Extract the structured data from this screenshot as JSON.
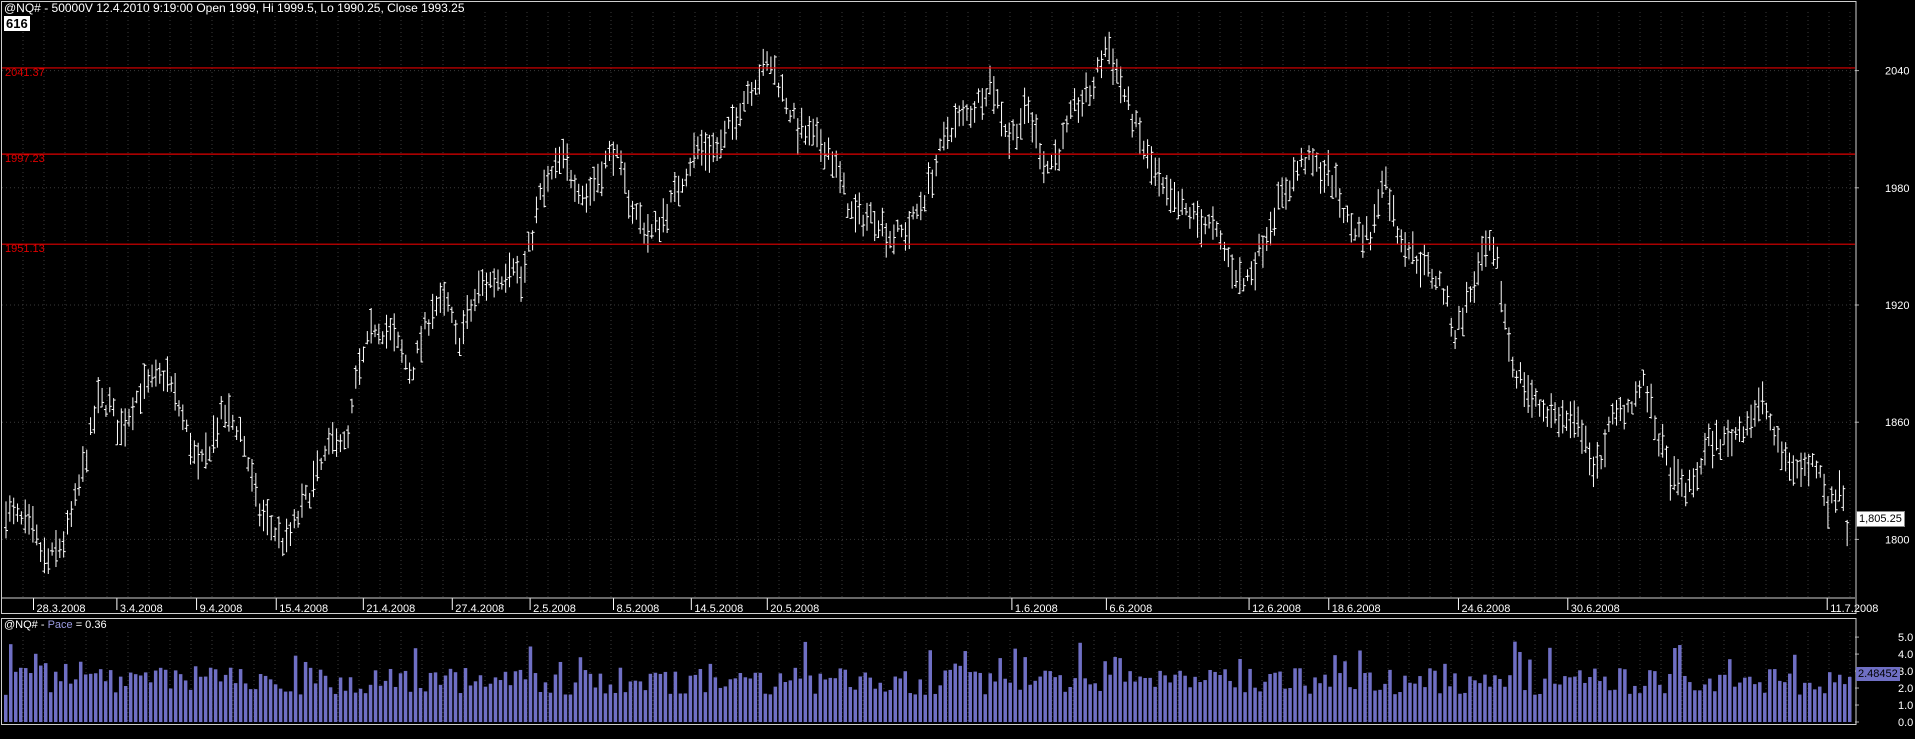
{
  "header": {
    "title": "@NQ# - 50000V 12.4.2010 9:19:00 Open 1999, Hi 1999.5, Lo 1990.25, Close 1993.25",
    "badge": "616"
  },
  "subpanel": {
    "prefix": "@NQ# - ",
    "indicator": "Pace",
    "suffix": " = 0.36",
    "last_value": "2.48452"
  },
  "last_price_label": "1,805.25",
  "colors": {
    "background": "#000000",
    "price_bars": "#ffffff",
    "level_lines": "#e00000",
    "pace_bars": "#6f6fc4",
    "grid": "#3a3a3a"
  },
  "chart_data": [
    {
      "type": "bar",
      "style": "ohlc",
      "ylim": [
        1770,
        2070
      ],
      "y_ticks": [
        1800,
        1860,
        1920,
        1980,
        2040
      ],
      "y_tick_labels": [
        "1800",
        "1860",
        "1920",
        "1980",
        "2040"
      ],
      "x_tick_labels": [
        "28.3.2008",
        "3.4.2008",
        "9.4.2008",
        "15.4.2008",
        "21.4.2008",
        "27.4.2008",
        "2.5.2008",
        "8.5.2008",
        "14.5.2008",
        "20.5.2008",
        "1.6.2008",
        "6.6.2008",
        "12.6.2008",
        "18.6.2008",
        "24.6.2008",
        "30.6.2008",
        "11.7.2008"
      ],
      "x_tick_positions": [
        0.017,
        0.062,
        0.105,
        0.148,
        0.195,
        0.243,
        0.285,
        0.33,
        0.372,
        0.413,
        0.545,
        0.596,
        0.673,
        0.716,
        0.786,
        0.845,
        0.985
      ],
      "levels": [
        {
          "value": 2041.37,
          "label": "2041.37"
        },
        {
          "value": 1997.23,
          "label": "1997.23"
        },
        {
          "value": 1951.13,
          "label": "1951.13"
        }
      ],
      "last_value": 1805.25,
      "grid": true,
      "anchor_path": [
        [
          0.0,
          1815
        ],
        [
          0.014,
          1805
        ],
        [
          0.022,
          1787
        ],
        [
          0.032,
          1800
        ],
        [
          0.038,
          1820
        ],
        [
          0.05,
          1870
        ],
        [
          0.056,
          1870
        ],
        [
          0.062,
          1855
        ],
        [
          0.072,
          1875
        ],
        [
          0.087,
          1885
        ],
        [
          0.095,
          1865
        ],
        [
          0.105,
          1835
        ],
        [
          0.118,
          1865
        ],
        [
          0.128,
          1855
        ],
        [
          0.137,
          1815
        ],
        [
          0.152,
          1797
        ],
        [
          0.165,
          1825
        ],
        [
          0.18,
          1855
        ],
        [
          0.185,
          1845
        ],
        [
          0.19,
          1880
        ],
        [
          0.2,
          1910
        ],
        [
          0.21,
          1905
        ],
        [
          0.22,
          1885
        ],
        [
          0.232,
          1920
        ],
        [
          0.24,
          1920
        ],
        [
          0.245,
          1900
        ],
        [
          0.258,
          1930
        ],
        [
          0.27,
          1935
        ],
        [
          0.275,
          1945
        ],
        [
          0.28,
          1930
        ],
        [
          0.29,
          1975
        ],
        [
          0.302,
          1995
        ],
        [
          0.315,
          1975
        ],
        [
          0.33,
          2000
        ],
        [
          0.34,
          1970
        ],
        [
          0.35,
          1955
        ],
        [
          0.36,
          1970
        ],
        [
          0.375,
          2000
        ],
        [
          0.388,
          2000
        ],
        [
          0.403,
          2030
        ],
        [
          0.415,
          2045
        ],
        [
          0.43,
          2010
        ],
        [
          0.447,
          2000
        ],
        [
          0.46,
          1965
        ],
        [
          0.473,
          1965
        ],
        [
          0.48,
          1955
        ],
        [
          0.49,
          1958
        ],
        [
          0.5,
          1978
        ],
        [
          0.512,
          2010
        ],
        [
          0.525,
          2020
        ],
        [
          0.535,
          2035
        ],
        [
          0.545,
          2005
        ],
        [
          0.555,
          2020
        ],
        [
          0.565,
          1990
        ],
        [
          0.573,
          2000
        ],
        [
          0.58,
          2020
        ],
        [
          0.59,
          2030
        ],
        [
          0.598,
          2055
        ],
        [
          0.61,
          2020
        ],
        [
          0.62,
          1995
        ],
        [
          0.63,
          1975
        ],
        [
          0.645,
          1965
        ],
        [
          0.655,
          1960
        ],
        [
          0.663,
          1945
        ],
        [
          0.672,
          1930
        ],
        [
          0.68,
          1945
        ],
        [
          0.69,
          1970
        ],
        [
          0.705,
          1995
        ],
        [
          0.72,
          1985
        ],
        [
          0.73,
          1960
        ],
        [
          0.742,
          1955
        ],
        [
          0.748,
          1990
        ],
        [
          0.755,
          1960
        ],
        [
          0.765,
          1945
        ],
        [
          0.78,
          1930
        ],
        [
          0.787,
          1905
        ],
        [
          0.795,
          1925
        ],
        [
          0.805,
          1950
        ],
        [
          0.81,
          1940
        ],
        [
          0.818,
          1890
        ],
        [
          0.83,
          1870
        ],
        [
          0.848,
          1860
        ],
        [
          0.858,
          1855
        ],
        [
          0.862,
          1830
        ],
        [
          0.872,
          1860
        ],
        [
          0.882,
          1870
        ],
        [
          0.89,
          1880
        ],
        [
          0.895,
          1860
        ],
        [
          0.905,
          1830
        ],
        [
          0.915,
          1825
        ],
        [
          0.925,
          1850
        ],
        [
          0.935,
          1850
        ],
        [
          0.945,
          1860
        ],
        [
          0.955,
          1870
        ],
        [
          0.963,
          1845
        ],
        [
          0.973,
          1835
        ],
        [
          0.985,
          1840
        ],
        [
          0.99,
          1815
        ],
        [
          0.997,
          1830
        ],
        [
          1.0,
          1805
        ]
      ]
    },
    {
      "type": "bar",
      "name": "Pace",
      "ylim": [
        0,
        5.3
      ],
      "y_ticks": [
        0,
        1,
        2,
        3,
        4,
        5
      ],
      "y_tick_labels": [
        "0.0",
        "1.0",
        "2.0",
        "3.0",
        "4.0",
        "5.0"
      ],
      "last_value": 2.48452
    }
  ]
}
